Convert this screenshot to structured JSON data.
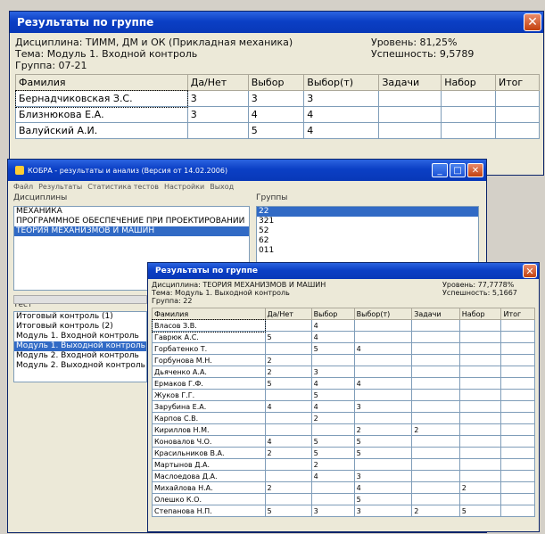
{
  "w1": {
    "title": "Результаты по группе",
    "info": {
      "discipline": "Дисциплина: ТИММ, ДМ и ОК (Прикладная механика)",
      "theme": "Тема: Модуль 1. Входной контроль",
      "group": "Группа: 07-21",
      "level": "Уровень: 81,25%",
      "success": "Успешность: 9,5789"
    },
    "columns": [
      "Фамилия",
      "Да/Нет",
      "Выбор",
      "Выбор(т)",
      "Задачи",
      "Набор",
      "Итог"
    ],
    "rows": [
      [
        "Бернадчиковская З.С.",
        "3",
        "3",
        "3",
        "",
        "",
        ""
      ],
      [
        "Близнюкова Е.А.",
        "3",
        "4",
        "4",
        "",
        "",
        ""
      ],
      [
        "Валуйский А.И.",
        "",
        "5",
        "4",
        "",
        "",
        ""
      ]
    ]
  },
  "w2": {
    "title": "КОБРА - результаты и анализ (Версия от 14.02.2006)",
    "menu": [
      "Файл",
      "Результаты",
      "Статистика тестов",
      "Настройки",
      "Выход"
    ],
    "discipline_label": "Дисциплины",
    "group_label": "Группы",
    "disciplines": [
      "МЕХАНИКА",
      "ПРОГРАММНОЕ ОБЕСПЕЧЕНИЕ ПРИ ПРОЕКТИРОВАНИИ",
      "ТЕОРИЯ МЕХАНИЗМОВ И МАШИН"
    ],
    "groups": [
      "22",
      "321",
      "52",
      "62",
      "011"
    ],
    "test_label": "Тест",
    "tests": [
      "Итоговый контроль (1)",
      "Итоговый контроль (2)",
      "Модуль 1. Входной контроль",
      "Модуль 1. Выходной контроль",
      "Модуль 2. Входной контроль",
      "Модуль 2. Выходной контроль"
    ]
  },
  "w3": {
    "title": "Результаты по группе",
    "info": {
      "discipline": "Дисциплина: ТЕОРИЯ МЕХАНИЗМОВ И МАШИН",
      "theme": "Тема: Модуль 1. Выходной контроль",
      "group": "Группа: 22",
      "level": "Уровень: 77,7778%",
      "success": "Успешность: 5,1667"
    },
    "columns": [
      "Фамилия",
      "Да/Нет",
      "Выбор",
      "Выбор(т)",
      "Задачи",
      "Набор",
      "Итог"
    ],
    "rows": [
      [
        "Власов З.В.",
        "",
        "4",
        "",
        "",
        "",
        ""
      ],
      [
        "Гаврюк А.С.",
        "5",
        "4",
        "",
        "",
        "",
        ""
      ],
      [
        "Горбатенко Т.",
        "",
        "5",
        "4",
        "",
        "",
        ""
      ],
      [
        "Горбунова М.Н.",
        "2",
        "",
        "",
        "",
        "",
        ""
      ],
      [
        "Дьяченко А.А.",
        "2",
        "3",
        "",
        "",
        "",
        ""
      ],
      [
        "Ермаков Г.Ф.",
        "5",
        "4",
        "4",
        "",
        "",
        ""
      ],
      [
        "Жуков Г.Г.",
        "",
        "5",
        "",
        "",
        "",
        ""
      ],
      [
        "Зарубина Е.А.",
        "4",
        "4",
        "3",
        "",
        "",
        ""
      ],
      [
        "Карпов С.В.",
        "",
        "2",
        "",
        "",
        "",
        ""
      ],
      [
        "Кириллов Н.М.",
        "",
        "",
        "2",
        "2",
        "",
        ""
      ],
      [
        "Коновалов Ч.О.",
        "4",
        "5",
        "5",
        "",
        "",
        ""
      ],
      [
        "Красильников В.А.",
        "2",
        "5",
        "5",
        "",
        "",
        ""
      ],
      [
        "Мартынов Д.А.",
        "",
        "2",
        "",
        "",
        "",
        ""
      ],
      [
        "Маслоедова Д.А.",
        "",
        "4",
        "3",
        "",
        "",
        ""
      ],
      [
        "Михайлова Н.А.",
        "2",
        "",
        "4",
        "",
        "2",
        ""
      ],
      [
        "Олешко К.О.",
        "",
        "",
        "5",
        "",
        "",
        ""
      ],
      [
        "Степанова Н.П.",
        "5",
        "3",
        "3",
        "2",
        "5",
        ""
      ]
    ]
  }
}
